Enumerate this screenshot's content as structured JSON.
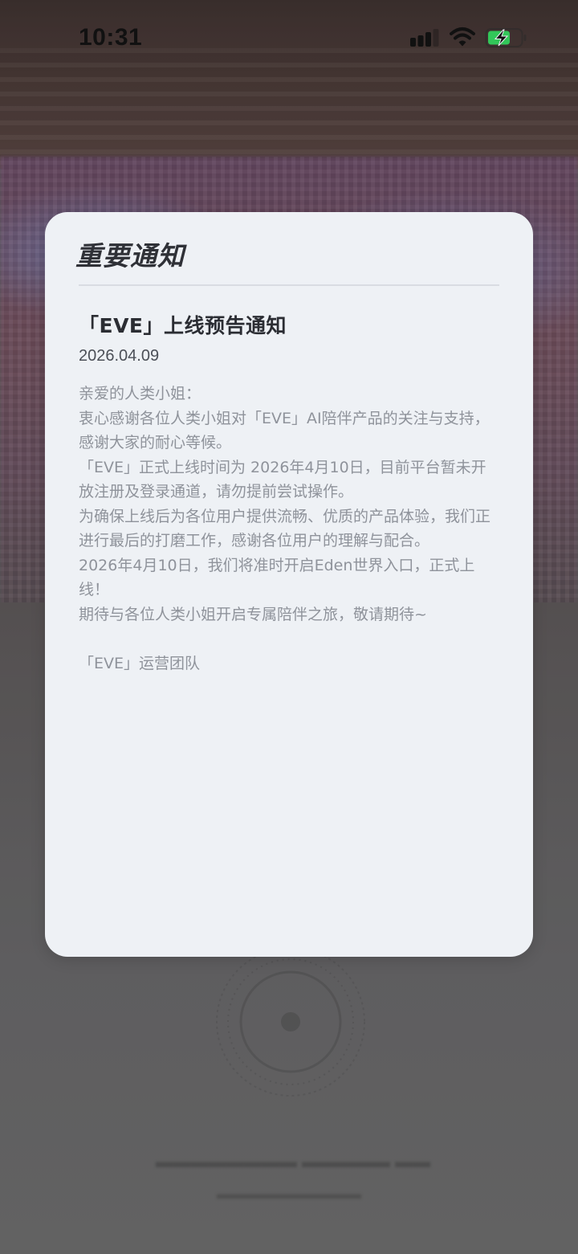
{
  "status_bar": {
    "time": "10:31",
    "icons": [
      "signal-icon",
      "wifi-icon",
      "battery-charging-icon"
    ],
    "battery_color": "#32c759"
  },
  "modal": {
    "title": "重要通知",
    "notice": {
      "heading": "「EVE」上线预告通知",
      "date": "2026.04.09",
      "paragraphs": [
        "亲爱的人类小姐：",
        "衷心感谢各位人类小姐对「EVE」AI陪伴产品的关注与支持，感谢大家的耐心等候。",
        "「EVE」正式上线时间为 2026年4月10日，目前平台暂未开放注册及登录通道，请勿提前尝试操作。",
        "为确保上线后为各位用户提供流畅、优质的产品体验，我们正进行最后的打磨工作，感谢各位用户的理解与配合。",
        "2026年4月10日，我们将准时开启Eden世界入口，正式上线！",
        "期待与各位人类小姐开启专属陪伴之旅，敬请期待~"
      ],
      "signature": "「EVE」运营团队"
    }
  },
  "colors": {
    "card_background": "#eef1f5",
    "title_text": "#2f3137",
    "body_text": "#8f939b",
    "date_text": "#4b4f57"
  }
}
